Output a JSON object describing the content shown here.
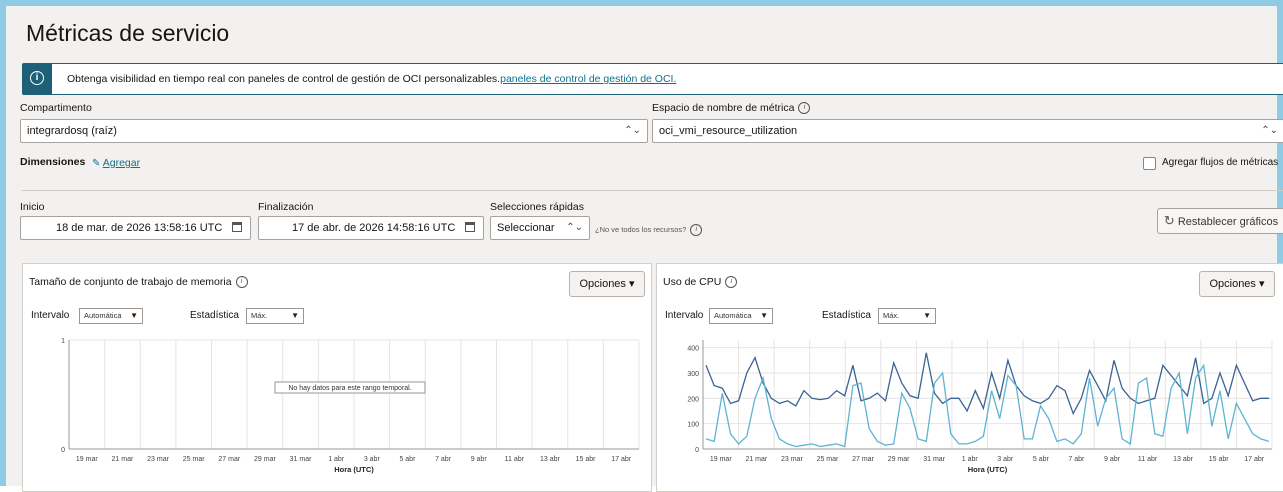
{
  "page": {
    "title": "Métricas de servicio"
  },
  "banner": {
    "text": "Obtenga visibilidad en tiempo real con paneles de control de gestión de OCI personalizables.",
    "link": "paneles de control de gestión de OCI."
  },
  "compartment": {
    "label": "Compartimento",
    "value": "integrardosq (raíz)"
  },
  "namespace": {
    "label": "Espacio de nombre de métrica",
    "value": "oci_vmi_resource_utilization"
  },
  "dimensions": {
    "label": "Dimensiones",
    "add_link": "Agregar"
  },
  "metric_streams": {
    "label": "Agregar flujos de métricas"
  },
  "time": {
    "start_label": "Inicio",
    "start_value": "18 de mar. de 2026 13:58:16 UTC",
    "end_label": "Finalización",
    "end_value": "17 de abr. de 2026 14:58:16 UTC",
    "quick_label": "Selecciones rápidas",
    "quick_value": "Seleccionar",
    "missing_resources": "¿No ve todos los recursos?"
  },
  "reset_button": "Restablecer gráficos",
  "panels": [
    {
      "title": "Tamaño de conjunto de trabajo de memoria",
      "options": "Opciones",
      "interval_label": "Intervalo",
      "interval_value": "Automática",
      "stat_label": "Estadística",
      "stat_value": "Máx.",
      "no_data": "No hay datos para este rango temporal."
    },
    {
      "title": "Uso de CPU",
      "options": "Opciones",
      "interval_label": "Intervalo",
      "interval_value": "Automática",
      "stat_label": "Estadística",
      "stat_value": "Máx."
    }
  ],
  "chart_data": [
    {
      "type": "line",
      "title": "Tamaño de conjunto de trabajo de memoria",
      "xlabel": "Hora (UTC)",
      "x_ticks": [
        "19 mar",
        "21 mar",
        "23 mar",
        "25 mar",
        "27 mar",
        "29 mar",
        "31 mar",
        "1 abr",
        "3 abr",
        "5 abr",
        "7 abr",
        "9 abr",
        "11 abr",
        "13 abr",
        "15 abr",
        "17 abr"
      ],
      "y_ticks": [
        0,
        1
      ],
      "ylim": [
        0,
        1
      ],
      "series": [],
      "grid": true
    },
    {
      "type": "line",
      "title": "Uso de CPU",
      "xlabel": "Hora (UTC)",
      "x_ticks": [
        "19 mar",
        "21 mar",
        "23 mar",
        "25 mar",
        "27 mar",
        "29 mar",
        "31 mar",
        "1 abr",
        "3 abr",
        "5 abr",
        "7 abr",
        "9 abr",
        "11 abr",
        "13 abr",
        "15 abr",
        "17 abr"
      ],
      "y_ticks": [
        0,
        100,
        200,
        300,
        400
      ],
      "ylim": [
        0,
        430
      ],
      "grid": true,
      "colors": [
        "#3b6393",
        "#5fb3d3"
      ],
      "series": [
        {
          "values": [
            330,
            250,
            240,
            180,
            190,
            300,
            360,
            260,
            200,
            180,
            190,
            170,
            230,
            200,
            195,
            200,
            230,
            210,
            330,
            190,
            200,
            220,
            190,
            340,
            260,
            210,
            200,
            380,
            220,
            180,
            200,
            200,
            150,
            230,
            160,
            300,
            200,
            350,
            250,
            210,
            190,
            180,
            200,
            250,
            230,
            140,
            200,
            310,
            250,
            190,
            350,
            240,
            200,
            180,
            190,
            200,
            330,
            290,
            250,
            210,
            360,
            180,
            200,
            300,
            210,
            330,
            260,
            190,
            200,
            200
          ]
        },
        {
          "values": [
            40,
            30,
            220,
            60,
            20,
            50,
            200,
            280,
            120,
            40,
            20,
            10,
            15,
            20,
            10,
            15,
            20,
            10,
            250,
            260,
            80,
            30,
            15,
            20,
            220,
            160,
            40,
            30,
            260,
            300,
            60,
            20,
            20,
            30,
            50,
            230,
            120,
            290,
            250,
            40,
            40,
            170,
            120,
            30,
            40,
            20,
            60,
            280,
            90,
            200,
            240,
            40,
            20,
            260,
            280,
            60,
            50,
            240,
            300,
            60,
            280,
            330,
            90,
            230,
            40,
            180,
            120,
            60,
            40,
            30
          ]
        }
      ]
    }
  ]
}
